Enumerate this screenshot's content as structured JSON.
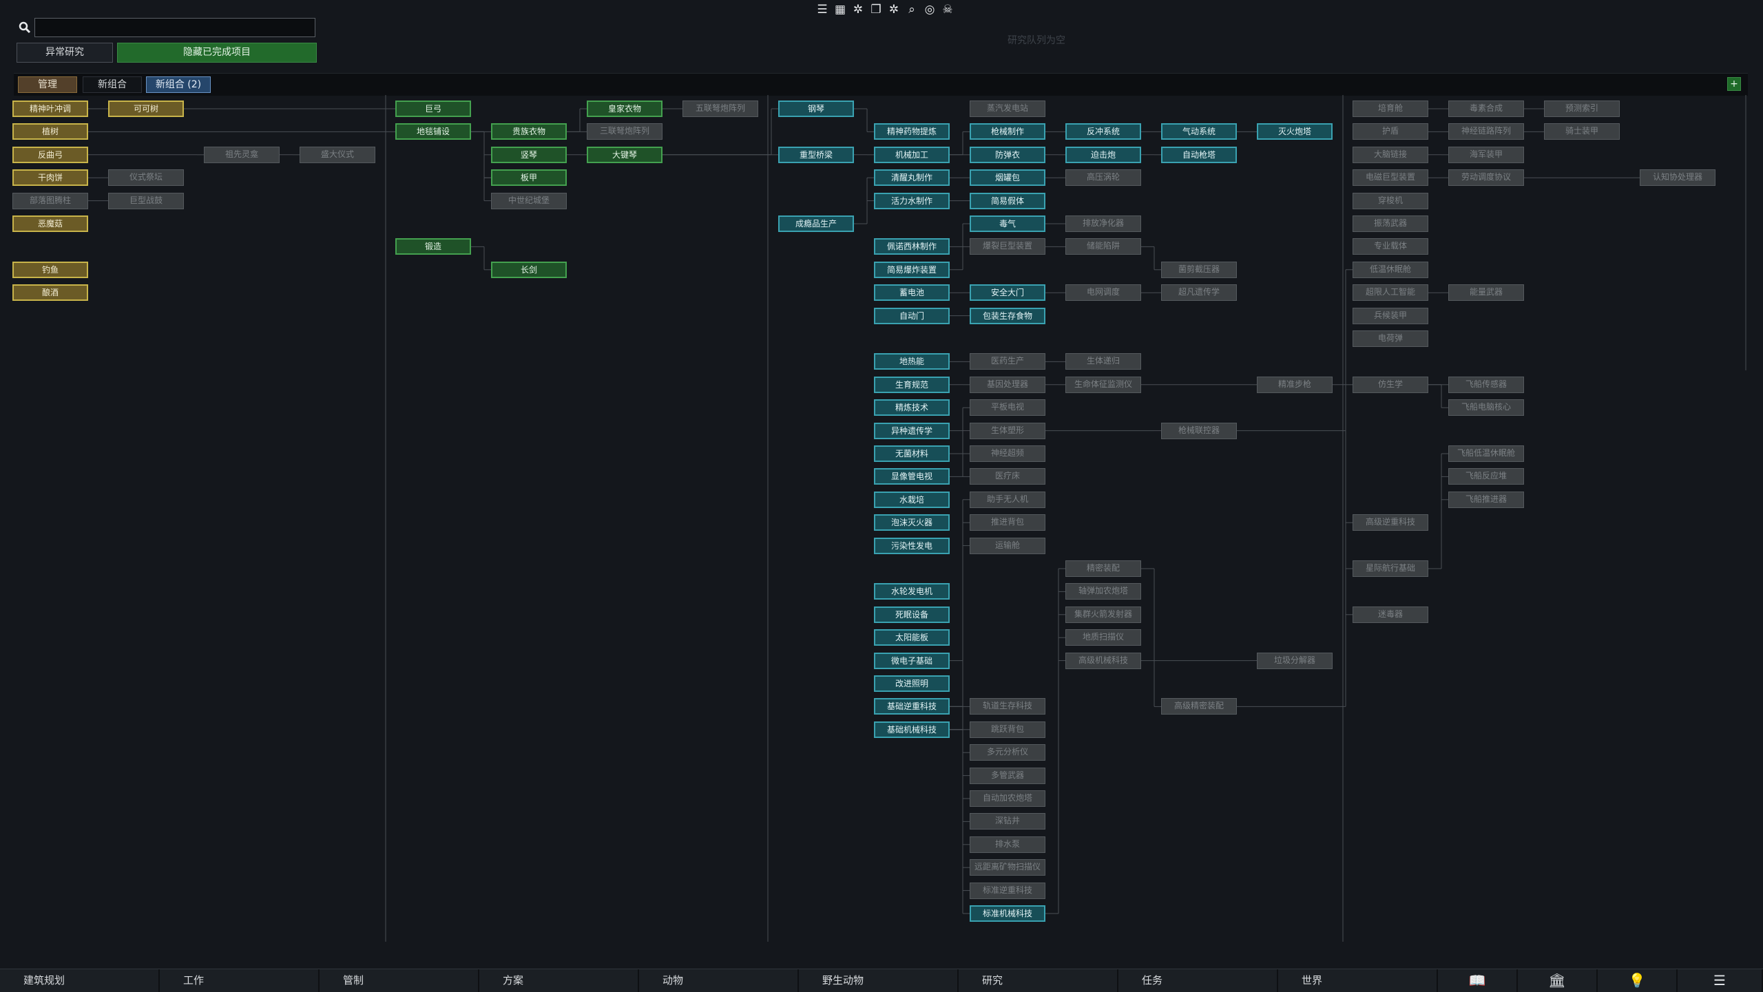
{
  "search": {
    "placeholder": ""
  },
  "buttons": {
    "anomaly": "异常研究",
    "hide_completed": "隐藏已完成项目"
  },
  "queue_status": "研究队列为空",
  "top_icons": [
    "list-icon",
    "table-icon",
    "gear-icon",
    "layers-icon",
    "gear-icon",
    "magnifier-icon",
    "target-icon",
    "skull-icon"
  ],
  "tabs": {
    "manage": "管理",
    "new": "新组合",
    "new2": "新组合 (2)",
    "add": "+"
  },
  "colors": {
    "completed_yellow": "#c8b44a",
    "completed_green": "#44a14f",
    "available_teal": "#3aa2b1",
    "locked_gray": "#555a5e"
  },
  "nodes": [
    {
      "id": "n1",
      "label": "精神叶冲调",
      "c": 1,
      "r": 0,
      "s": "yellow"
    },
    {
      "id": "n2",
      "label": "植树",
      "c": 1,
      "r": 1,
      "s": "yellow"
    },
    {
      "id": "n3",
      "label": "反曲弓",
      "c": 1,
      "r": 2,
      "s": "yellow"
    },
    {
      "id": "n4",
      "label": "干肉饼",
      "c": 1,
      "r": 3,
      "s": "yellow"
    },
    {
      "id": "n5",
      "label": "部落图腾柱",
      "c": 1,
      "r": 4,
      "s": "gray"
    },
    {
      "id": "n6",
      "label": "恶魔菇",
      "c": 1,
      "r": 5,
      "s": "yellow"
    },
    {
      "id": "n7",
      "label": "钓鱼",
      "c": 1,
      "r": 7,
      "s": "yellow"
    },
    {
      "id": "n8",
      "label": "酿酒",
      "c": 1,
      "r": 8,
      "s": "yellow"
    },
    {
      "id": "n9",
      "label": "可可树",
      "c": 2,
      "r": 0,
      "s": "yellow"
    },
    {
      "id": "n10",
      "label": "仪式祭坛",
      "c": 2,
      "r": 3,
      "s": "gray"
    },
    {
      "id": "n11",
      "label": "巨型战鼓",
      "c": 2,
      "r": 4,
      "s": "gray"
    },
    {
      "id": "n12",
      "label": "祖先灵龛",
      "c": 3,
      "r": 2,
      "s": "gray"
    },
    {
      "id": "n13",
      "label": "盛大仪式",
      "c": 4,
      "r": 2,
      "s": "gray"
    },
    {
      "id": "n14",
      "label": "巨弓",
      "c": 5,
      "r": 0,
      "s": "green"
    },
    {
      "id": "n15",
      "label": "地毯铺设",
      "c": 5,
      "r": 1,
      "s": "green"
    },
    {
      "id": "n16",
      "label": "锻造",
      "c": 5,
      "r": 6,
      "s": "green"
    },
    {
      "id": "n17",
      "label": "贵族衣物",
      "c": 6,
      "r": 1,
      "s": "green"
    },
    {
      "id": "n18",
      "label": "竖琴",
      "c": 6,
      "r": 2,
      "s": "green"
    },
    {
      "id": "n19",
      "label": "板甲",
      "c": 6,
      "r": 3,
      "s": "green"
    },
    {
      "id": "n20",
      "label": "中世纪城堡",
      "c": 6,
      "r": 4,
      "s": "gray"
    },
    {
      "id": "n21",
      "label": "长剑",
      "c": 6,
      "r": 7,
      "s": "green"
    },
    {
      "id": "n22",
      "label": "皇家衣物",
      "c": 7,
      "r": 0,
      "s": "green"
    },
    {
      "id": "n23",
      "label": "三联弩炮阵列",
      "c": 7,
      "r": 1,
      "s": "gray"
    },
    {
      "id": "n24",
      "label": "大键琴",
      "c": 7,
      "r": 2,
      "s": "green"
    },
    {
      "id": "n25",
      "label": "五联弩炮阵列",
      "c": 8,
      "r": 0,
      "s": "gray"
    },
    {
      "id": "n26",
      "label": "钢琴",
      "c": 9,
      "r": 0,
      "s": "teal"
    },
    {
      "id": "n27",
      "label": "重型桥梁",
      "c": 9,
      "r": 2,
      "s": "teal"
    },
    {
      "id": "n28",
      "label": "成瘾品生产",
      "c": 9,
      "r": 5,
      "s": "teal"
    },
    {
      "id": "n29",
      "label": "精神药物提炼",
      "c": 10,
      "r": 1,
      "s": "teal"
    },
    {
      "id": "n30",
      "label": "机械加工",
      "c": 10,
      "r": 2,
      "s": "teal"
    },
    {
      "id": "n31",
      "label": "清醒丸制作",
      "c": 10,
      "r": 3,
      "s": "teal"
    },
    {
      "id": "n32",
      "label": "活力水制作",
      "c": 10,
      "r": 4,
      "s": "teal"
    },
    {
      "id": "n33",
      "label": "佩诺西林制作",
      "c": 10,
      "r": 6,
      "s": "teal"
    },
    {
      "id": "n34",
      "label": "简易爆炸装置",
      "c": 10,
      "r": 7,
      "s": "teal"
    },
    {
      "id": "n35",
      "label": "蓄电池",
      "c": 10,
      "r": 8,
      "s": "teal"
    },
    {
      "id": "n36",
      "label": "自动门",
      "c": 10,
      "r": 9,
      "s": "teal"
    },
    {
      "id": "n37",
      "label": "地热能",
      "c": 10,
      "r": 11,
      "s": "teal"
    },
    {
      "id": "n38",
      "label": "生育规范",
      "c": 10,
      "r": 12,
      "s": "teal"
    },
    {
      "id": "n39",
      "label": "精炼技术",
      "c": 10,
      "r": 13,
      "s": "teal"
    },
    {
      "id": "n40",
      "label": "异种遗传学",
      "c": 10,
      "r": 14,
      "s": "teal"
    },
    {
      "id": "n41",
      "label": "无菌材料",
      "c": 10,
      "r": 15,
      "s": "teal"
    },
    {
      "id": "n42",
      "label": "显像管电视",
      "c": 10,
      "r": 16,
      "s": "teal"
    },
    {
      "id": "n43",
      "label": "水栽培",
      "c": 10,
      "r": 17,
      "s": "teal"
    },
    {
      "id": "n44",
      "label": "泡沫灭火器",
      "c": 10,
      "r": 18,
      "s": "teal"
    },
    {
      "id": "n45",
      "label": "污染性发电",
      "c": 10,
      "r": 19,
      "s": "teal"
    },
    {
      "id": "n46",
      "label": "水轮发电机",
      "c": 10,
      "r": 21,
      "s": "teal"
    },
    {
      "id": "n47",
      "label": "死眠设备",
      "c": 10,
      "r": 22,
      "s": "teal"
    },
    {
      "id": "n48",
      "label": "太阳能板",
      "c": 10,
      "r": 23,
      "s": "teal"
    },
    {
      "id": "n49",
      "label": "微电子基础",
      "c": 10,
      "r": 24,
      "s": "teal"
    },
    {
      "id": "n50",
      "label": "改进照明",
      "c": 10,
      "r": 25,
      "s": "teal"
    },
    {
      "id": "n51",
      "label": "基础逆重科技",
      "c": 10,
      "r": 26,
      "s": "teal"
    },
    {
      "id": "n52",
      "label": "基础机械科技",
      "c": 10,
      "r": 27,
      "s": "teal"
    },
    {
      "id": "n53",
      "label": "蒸汽发电站",
      "c": 11,
      "r": 0,
      "s": "gray"
    },
    {
      "id": "n54",
      "label": "枪械制作",
      "c": 11,
      "r": 1,
      "s": "teal"
    },
    {
      "id": "n55",
      "label": "防弹衣",
      "c": 11,
      "r": 2,
      "s": "teal"
    },
    {
      "id": "n56",
      "label": "烟罐包",
      "c": 11,
      "r": 3,
      "s": "teal"
    },
    {
      "id": "n57",
      "label": "简易假体",
      "c": 11,
      "r": 4,
      "s": "teal"
    },
    {
      "id": "n58",
      "label": "毒气",
      "c": 11,
      "r": 5,
      "s": "teal"
    },
    {
      "id": "n59",
      "label": "爆裂巨型装置",
      "c": 11,
      "r": 6,
      "s": "gray"
    },
    {
      "id": "n60",
      "label": "安全大门",
      "c": 11,
      "r": 8,
      "s": "teal"
    },
    {
      "id": "n61",
      "label": "包装生存食物",
      "c": 11,
      "r": 9,
      "s": "teal"
    },
    {
      "id": "n62",
      "label": "医药生产",
      "c": 11,
      "r": 11,
      "s": "gray"
    },
    {
      "id": "n63",
      "label": "基因处理器",
      "c": 11,
      "r": 12,
      "s": "gray"
    },
    {
      "id": "n64",
      "label": "平板电视",
      "c": 11,
      "r": 13,
      "s": "gray"
    },
    {
      "id": "n65",
      "label": "生体塑形",
      "c": 11,
      "r": 14,
      "s": "gray"
    },
    {
      "id": "n66",
      "label": "神经超频",
      "c": 11,
      "r": 15,
      "s": "gray"
    },
    {
      "id": "n67",
      "label": "医疗床",
      "c": 11,
      "r": 16,
      "s": "gray"
    },
    {
      "id": "n68",
      "label": "助手无人机",
      "c": 11,
      "r": 17,
      "s": "gray"
    },
    {
      "id": "n69",
      "label": "推进背包",
      "c": 11,
      "r": 18,
      "s": "gray"
    },
    {
      "id": "n70",
      "label": "运输舱",
      "c": 11,
      "r": 19,
      "s": "gray"
    },
    {
      "id": "n71",
      "label": "轨道生存科技",
      "c": 11,
      "r": 26,
      "s": "gray"
    },
    {
      "id": "n72",
      "label": "跳跃背包",
      "c": 11,
      "r": 27,
      "s": "gray"
    },
    {
      "id": "n73",
      "label": "多元分析仪",
      "c": 11,
      "r": 28,
      "s": "gray"
    },
    {
      "id": "n74",
      "label": "多管武器",
      "c": 11,
      "r": 29,
      "s": "gray"
    },
    {
      "id": "n75",
      "label": "自动加农炮塔",
      "c": 11,
      "r": 30,
      "s": "gray"
    },
    {
      "id": "n76",
      "label": "深钻井",
      "c": 11,
      "r": 31,
      "s": "gray"
    },
    {
      "id": "n77",
      "label": "排水泵",
      "c": 11,
      "r": 32,
      "s": "gray"
    },
    {
      "id": "n78",
      "label": "远距离矿物扫描仪",
      "c": 11,
      "r": 33,
      "s": "gray"
    },
    {
      "id": "n79",
      "label": "标准逆重科技",
      "c": 11,
      "r": 34,
      "s": "gray"
    },
    {
      "id": "n80",
      "label": "标准机械科技",
      "c": 11,
      "r": 35,
      "s": "teal"
    },
    {
      "id": "n81",
      "label": "反冲系统",
      "c": 12,
      "r": 1,
      "s": "teal"
    },
    {
      "id": "n82",
      "label": "迫击炮",
      "c": 12,
      "r": 2,
      "s": "teal"
    },
    {
      "id": "n83",
      "label": "高压涡轮",
      "c": 12,
      "r": 3,
      "s": "gray"
    },
    {
      "id": "n84",
      "label": "排放净化器",
      "c": 12,
      "r": 5,
      "s": "gray"
    },
    {
      "id": "n85",
      "label": "储能陷阱",
      "c": 12,
      "r": 6,
      "s": "gray"
    },
    {
      "id": "n86",
      "label": "电网调度",
      "c": 12,
      "r": 8,
      "s": "gray"
    },
    {
      "id": "n87",
      "label": "生体递归",
      "c": 12,
      "r": 11,
      "s": "gray"
    },
    {
      "id": "n88",
      "label": "生命体征监测仪",
      "c": 12,
      "r": 12,
      "s": "gray"
    },
    {
      "id": "n89",
      "label": "精密装配",
      "c": 12,
      "r": 20,
      "s": "gray"
    },
    {
      "id": "n90",
      "label": "轴弹加农炮塔",
      "c": 12,
      "r": 21,
      "s": "gray"
    },
    {
      "id": "n91",
      "label": "集群火箭发射器",
      "c": 12,
      "r": 22,
      "s": "gray"
    },
    {
      "id": "n92",
      "label": "地质扫描仪",
      "c": 12,
      "r": 23,
      "s": "gray"
    },
    {
      "id": "n93",
      "label": "高级机械科技",
      "c": 12,
      "r": 24,
      "s": "gray"
    },
    {
      "id": "n94",
      "label": "气动系统",
      "c": 13,
      "r": 1,
      "s": "teal"
    },
    {
      "id": "n95",
      "label": "自动枪塔",
      "c": 13,
      "r": 2,
      "s": "teal"
    },
    {
      "id": "n96",
      "label": "菌剪截压器",
      "c": 13,
      "r": 7,
      "s": "gray"
    },
    {
      "id": "n97",
      "label": "超凡遗传学",
      "c": 13,
      "r": 8,
      "s": "gray"
    },
    {
      "id": "n98",
      "label": "枪械联控器",
      "c": 13,
      "r": 14,
      "s": "gray"
    },
    {
      "id": "n99",
      "label": "高级精密装配",
      "c": 13,
      "r": 26,
      "s": "gray"
    },
    {
      "id": "n100",
      "label": "灭火炮塔",
      "c": 14,
      "r": 1,
      "s": "teal"
    },
    {
      "id": "n101",
      "label": "精准步枪",
      "c": 14,
      "r": 12,
      "s": "gray"
    },
    {
      "id": "n102",
      "label": "垃圾分解器",
      "c": 14,
      "r": 24,
      "s": "gray"
    },
    {
      "id": "n103",
      "label": "培育舱",
      "c": 15,
      "r": 0,
      "s": "gray"
    },
    {
      "id": "n104",
      "label": "护盾",
      "c": 15,
      "r": 1,
      "s": "gray"
    },
    {
      "id": "n105",
      "label": "大脑链接",
      "c": 15,
      "r": 2,
      "s": "gray"
    },
    {
      "id": "n106",
      "label": "电磁巨型装置",
      "c": 15,
      "r": 3,
      "s": "gray"
    },
    {
      "id": "n107",
      "label": "穿梭机",
      "c": 15,
      "r": 4,
      "s": "gray"
    },
    {
      "id": "n108",
      "label": "振荡武器",
      "c": 15,
      "r": 5,
      "s": "gray"
    },
    {
      "id": "n109",
      "label": "专业载体",
      "c": 15,
      "r": 6,
      "s": "gray"
    },
    {
      "id": "n110",
      "label": "低温休眠舱",
      "c": 15,
      "r": 7,
      "s": "gray"
    },
    {
      "id": "n111",
      "label": "超限人工智能",
      "c": 15,
      "r": 8,
      "s": "gray"
    },
    {
      "id": "n112",
      "label": "兵候装甲",
      "c": 15,
      "r": 9,
      "s": "gray"
    },
    {
      "id": "n113",
      "label": "电荷弹",
      "c": 15,
      "r": 10,
      "s": "gray"
    },
    {
      "id": "n114",
      "label": "仿生学",
      "c": 15,
      "r": 12,
      "s": "gray"
    },
    {
      "id": "n115",
      "label": "高级逆重科技",
      "c": 15,
      "r": 18,
      "s": "gray"
    },
    {
      "id": "n116",
      "label": "星际航行基础",
      "c": 15,
      "r": 20,
      "s": "gray"
    },
    {
      "id": "n117",
      "label": "迷毒器",
      "c": 15,
      "r": 22,
      "s": "gray"
    },
    {
      "id": "n118",
      "label": "毒素合成",
      "c": 16,
      "r": 0,
      "s": "gray"
    },
    {
      "id": "n119",
      "label": "神经链路阵列",
      "c": 16,
      "r": 1,
      "s": "gray"
    },
    {
      "id": "n120",
      "label": "海军装甲",
      "c": 16,
      "r": 2,
      "s": "gray"
    },
    {
      "id": "n121",
      "label": "劳动调度协议",
      "c": 16,
      "r": 3,
      "s": "gray"
    },
    {
      "id": "n122",
      "label": "能量武器",
      "c": 16,
      "r": 8,
      "s": "gray"
    },
    {
      "id": "n123",
      "label": "飞船传感器",
      "c": 16,
      "r": 12,
      "s": "gray"
    },
    {
      "id": "n124",
      "label": "飞船电脑核心",
      "c": 16,
      "r": 13,
      "s": "gray"
    },
    {
      "id": "n125",
      "label": "飞船低温休眠舱",
      "c": 16,
      "r": 15,
      "s": "gray"
    },
    {
      "id": "n126",
      "label": "飞船反应堆",
      "c": 16,
      "r": 16,
      "s": "gray"
    },
    {
      "id": "n127",
      "label": "飞船推进器",
      "c": 16,
      "r": 17,
      "s": "gray"
    },
    {
      "id": "n128",
      "label": "预测索引",
      "c": 17,
      "r": 0,
      "s": "gray"
    },
    {
      "id": "n129",
      "label": "骑士装甲",
      "c": 17,
      "r": 1,
      "s": "gray"
    },
    {
      "id": "n130",
      "label": "认知协处理器",
      "c": 18,
      "r": 3,
      "s": "gray"
    }
  ],
  "bottom_tabs": [
    "建筑规划",
    "工作",
    "管制",
    "方案",
    "动物",
    "野生动物",
    "研究",
    "任务",
    "世界"
  ],
  "bottom_icons": [
    "book-icon",
    "museum-icon",
    "lightbulb-icon",
    "menu-icon"
  ]
}
